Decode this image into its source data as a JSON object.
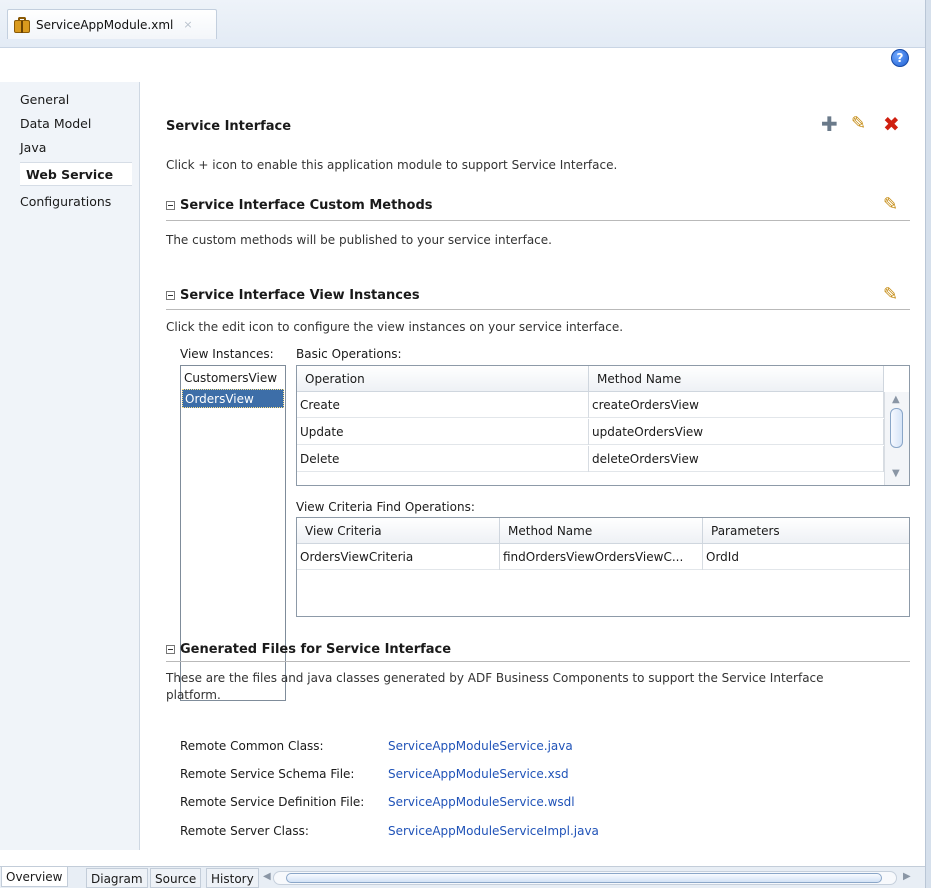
{
  "file_tab": {
    "label": "ServiceAppModule.xml",
    "close": "×"
  },
  "help": {
    "label": "?"
  },
  "nav": {
    "items": [
      {
        "label": "General"
      },
      {
        "label": "Data Model"
      },
      {
        "label": "Java"
      },
      {
        "label": "Web Service"
      },
      {
        "label": "Configurations"
      }
    ],
    "active": "Web Service"
  },
  "service_interface": {
    "title": "Service Interface",
    "description": "Click + icon to enable this application module to support Service Interface.",
    "icons": {
      "add": "plus-icon",
      "edit": "pencil-icon",
      "delete": "delete-x-icon"
    }
  },
  "custom_methods": {
    "title": "Service Interface Custom Methods",
    "description": "The custom methods will be published to your service interface."
  },
  "view_instances": {
    "title": "Service Interface View Instances",
    "description": "Click the edit icon to configure the view instances on your service interface.",
    "list_label": "View Instances:",
    "list": [
      "CustomersView",
      "OrdersView"
    ],
    "selected": "OrdersView",
    "basic_ops_label": "Basic Operations:",
    "basic_ops_headers": [
      "Operation",
      "Method Name"
    ],
    "basic_ops_rows": [
      [
        "Create",
        "createOrdersView"
      ],
      [
        "Update",
        "updateOrdersView"
      ],
      [
        "Delete",
        "deleteOrdersView"
      ]
    ],
    "criteria_label": "View Criteria Find Operations:",
    "criteria_headers": [
      "View Criteria",
      "Method Name",
      "Parameters"
    ],
    "criteria_rows": [
      [
        "OrdersViewCriteria",
        "findOrdersViewOrdersViewC...",
        "OrdId"
      ]
    ]
  },
  "generated_files": {
    "title": "Generated Files for Service Interface",
    "description_line1": "These are the files and java classes generated by ADF Business Components to support the Service Interface",
    "description_line2": "platform.",
    "files": [
      {
        "label": "Remote Common Class:",
        "value": "ServiceAppModuleService.java"
      },
      {
        "label": "Remote Service Schema File:",
        "value": "ServiceAppModuleService.xsd"
      },
      {
        "label": "Remote Service Definition File:",
        "value": "ServiceAppModuleService.wsdl"
      },
      {
        "label": "Remote Server Class:",
        "value": "ServiceAppModuleServiceImpl.java"
      }
    ]
  },
  "bottom_tabs": [
    {
      "label": "Overview"
    },
    {
      "label": "Diagram"
    },
    {
      "label": "Source"
    },
    {
      "label": "History"
    }
  ]
}
